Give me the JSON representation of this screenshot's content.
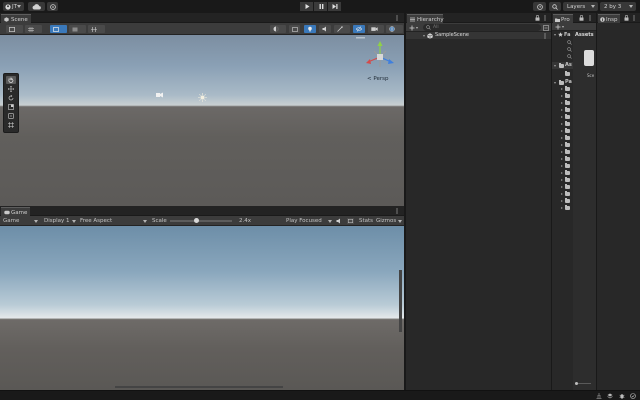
{
  "toolbar": {
    "account": "JT",
    "layers": "Layers",
    "layout": "2 by 3"
  },
  "scene": {
    "tab": "Scene",
    "persp": "< Persp"
  },
  "hierarchy": {
    "tab": "Hierarchy",
    "search_placeholder": "All",
    "scene_name": "SampleScene"
  },
  "project": {
    "tab": "Pro",
    "favorites": "Fa",
    "assets_root": "As",
    "packages_root": "Pa",
    "assets_header": "Assets",
    "asset_item": "Sce",
    "package_count": 18
  },
  "inspector": {
    "tab": "Insp"
  },
  "game": {
    "tab": "Game",
    "mode": "Game",
    "display": "Display 1",
    "aspect": "Free Aspect",
    "scale_label": "Scale",
    "scale_value": "2.4x",
    "scale_fraction": 0.42,
    "play_mode": "Play Focused",
    "stats": "Stats",
    "gizmos": "Gizmos"
  },
  "colors": {
    "accent": "#3a79bb",
    "panel": "#282828",
    "toolbar": "#191919"
  }
}
